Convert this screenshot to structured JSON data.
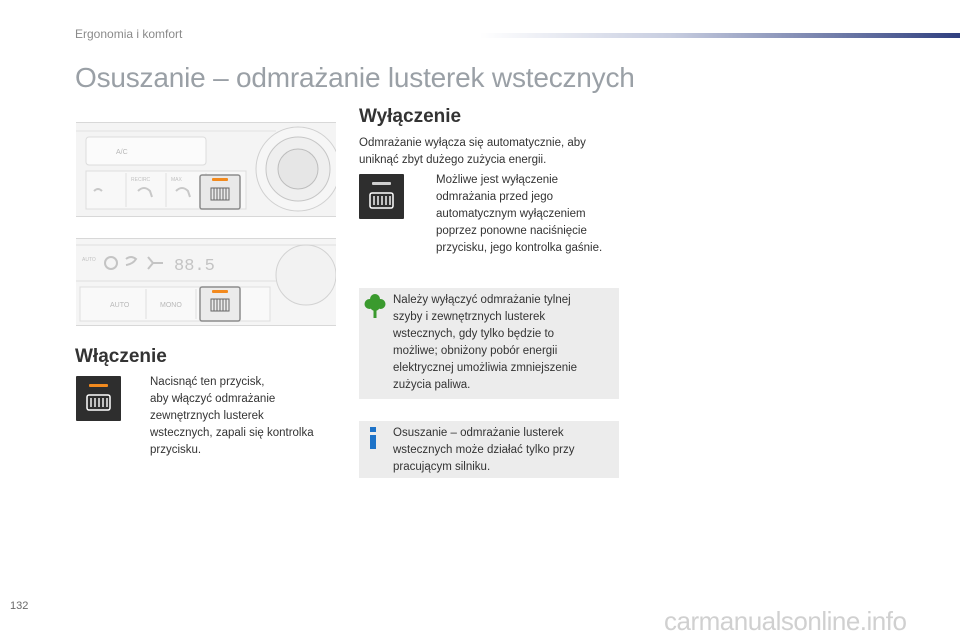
{
  "header": {
    "section": "Ergonomia i komfort"
  },
  "page_title": "Osuszanie – odmrażanie lusterek wstecznych",
  "panel_photo_1": {
    "ac_label": "A/C",
    "recirc_label": "RECIRC",
    "defrost_label": "MAX"
  },
  "panel_photo_2": {
    "auto_soft": "AUTO",
    "temp_readout": "88.5",
    "auto_label": "AUTO",
    "mono_label": "MONO"
  },
  "sections": {
    "on": {
      "heading": "Włączenie",
      "bullet": "",
      "text_lines": [
        "Nacisnąć ten przycisk,",
        "aby włączyć odmrażanie",
        "zewnętrznych lusterek",
        "wstecznych, zapali się kontrolka",
        "przycisku."
      ]
    },
    "off": {
      "heading": "Wyłączenie",
      "intro_lines": [
        "Odmrażanie wyłącza się automatycznie, aby",
        "uniknąć zbyt dużego zużycia energii."
      ],
      "bullet": "",
      "text_lines": [
        "Możliwe jest wyłączenie",
        "odmrażania przed jego",
        "automatycznym wyłączeniem",
        "poprzez ponowne naciśnięcie",
        "przycisku, jego kontrolka gaśnie."
      ]
    }
  },
  "notes": {
    "eco": {
      "icon": "tree-icon",
      "lines": [
        "Należy wyłączyć odmrażanie tylnej",
        "szyby i zewnętrznych lusterek",
        "wstecznych, gdy tylko będzie to",
        "możliwe; obniżony pobór energii",
        "elektrycznej umożliwia zmniejszenie",
        "zużycia paliwa."
      ]
    },
    "info": {
      "icon": "info-icon",
      "lines": [
        "Osuszanie – odmrażanie lusterek",
        "wstecznych może działać tylko przy",
        "pracującym silniku."
      ]
    }
  },
  "colors": {
    "indicator_on": "#f28a1e",
    "indicator_off": "#cfcfcf",
    "eco_green": "#3a9a2e",
    "info_blue": "#1e73c8",
    "accent_navy": "#2f3f7f"
  },
  "page_number": "132",
  "watermark": "carmanualsonline.info"
}
